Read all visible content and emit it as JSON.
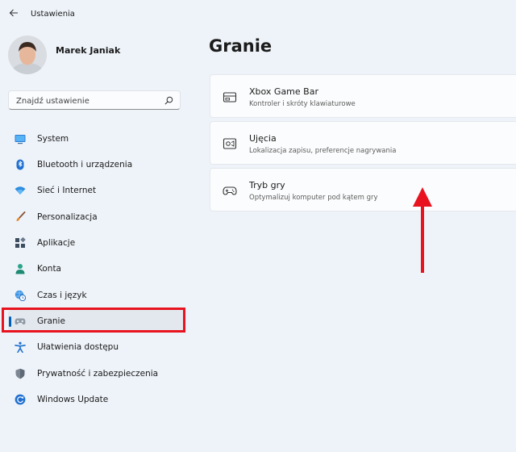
{
  "app": {
    "title": "Ustawienia"
  },
  "user": {
    "name": "Marek Janiak"
  },
  "search": {
    "placeholder": "Znajdź ustawienie"
  },
  "sidebar": {
    "items": [
      {
        "label": "System",
        "icon": "monitor-icon"
      },
      {
        "label": "Bluetooth i urządzenia",
        "icon": "bluetooth-icon"
      },
      {
        "label": "Sieć i Internet",
        "icon": "wifi-icon"
      },
      {
        "label": "Personalizacja",
        "icon": "brush-icon"
      },
      {
        "label": "Aplikacje",
        "icon": "apps-icon"
      },
      {
        "label": "Konta",
        "icon": "person-icon"
      },
      {
        "label": "Czas i język",
        "icon": "globe-clock-icon"
      },
      {
        "label": "Granie",
        "icon": "gamepad-icon",
        "selected": true
      },
      {
        "label": "Ułatwienia dostępu",
        "icon": "accessibility-icon"
      },
      {
        "label": "Prywatność i zabezpieczenia",
        "icon": "shield-icon"
      },
      {
        "label": "Windows Update",
        "icon": "update-icon"
      }
    ]
  },
  "main": {
    "title": "Granie",
    "cards": [
      {
        "title": "Xbox Game Bar",
        "subtitle": "Kontroler i skróty klawiaturowe",
        "icon": "game-bar-icon"
      },
      {
        "title": "Ujęcia",
        "subtitle": "Lokalizacja zapisu, preferencje nagrywania",
        "icon": "capture-icon"
      },
      {
        "title": "Tryb gry",
        "subtitle": "Optymalizuj komputer pod kątem gry",
        "icon": "controller-icon"
      }
    ]
  },
  "colors": {
    "accent": "#005fb8",
    "highlight": "#e8131e",
    "background": "#eef3f9"
  }
}
